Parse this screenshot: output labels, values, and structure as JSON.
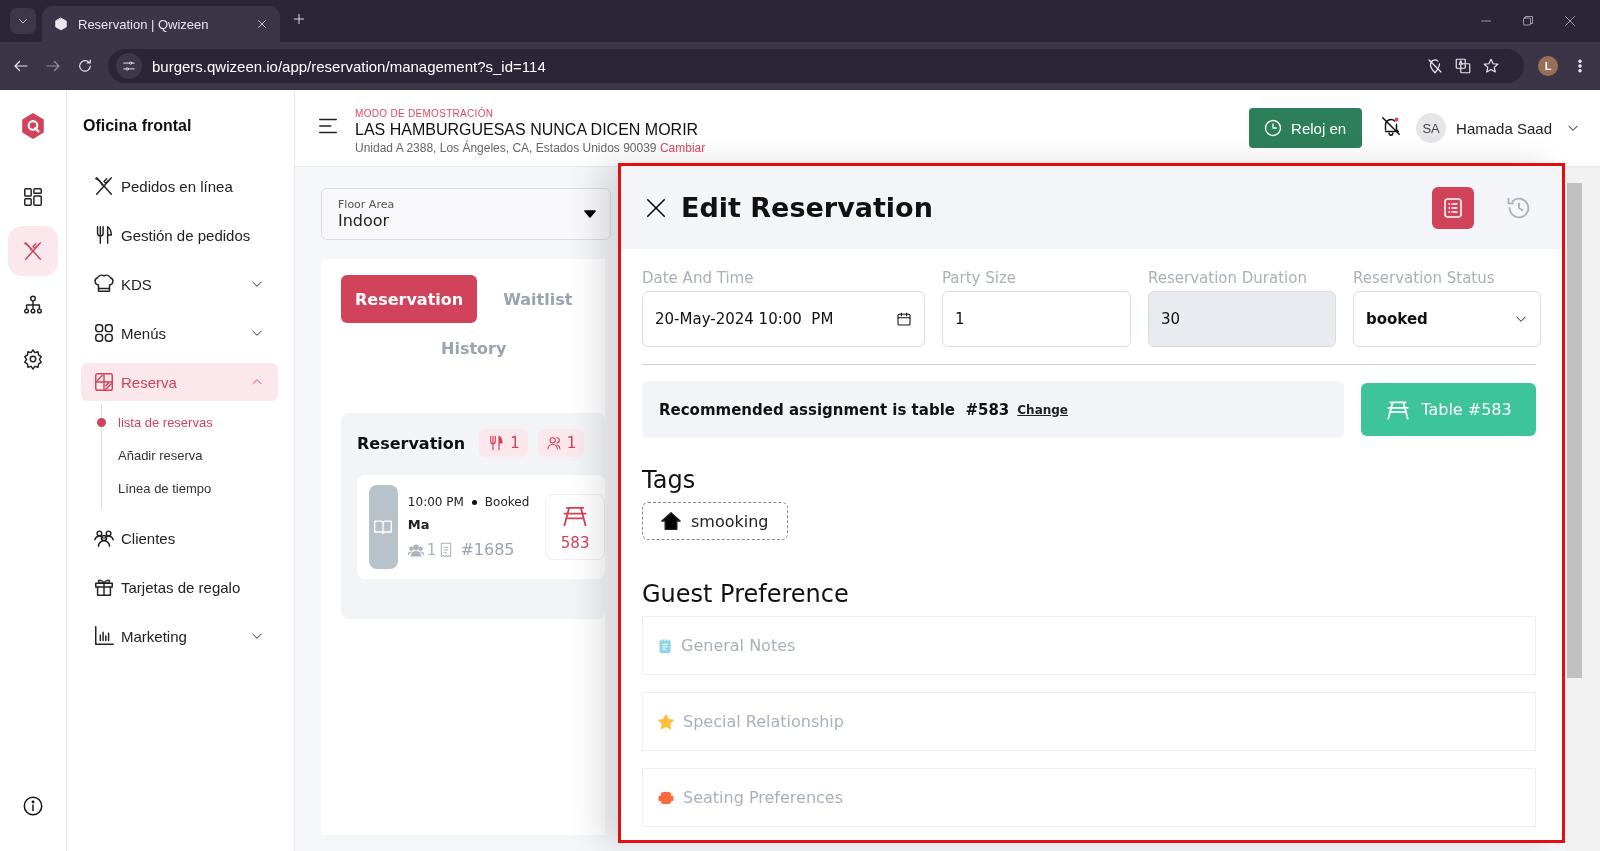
{
  "browser": {
    "tab_title": "Reservation | Qwizeen",
    "url": "burgers.qwizeen.io/app/reservation/management?s_id=114",
    "profile_initial": "L"
  },
  "rail": {
    "items": [
      {
        "kind": "dashboard",
        "selected": false
      },
      {
        "kind": "dining",
        "selected": true
      },
      {
        "kind": "hierarchy",
        "selected": false
      },
      {
        "kind": "settings",
        "selected": false
      }
    ]
  },
  "sidebar": {
    "title": "Oficina frontal",
    "items": [
      {
        "label": "Pedidos en línea",
        "kind": "dining",
        "selected": false
      },
      {
        "label": "Gestión de pedidos",
        "kind": "utensils",
        "selected": false
      },
      {
        "label": "KDS",
        "kind": "chef",
        "selected": false,
        "expanded": false
      },
      {
        "label": "Menús",
        "kind": "grid",
        "selected": false,
        "expanded": false
      },
      {
        "label": "Reserva",
        "kind": "floorplan",
        "selected": true,
        "expanded": true,
        "children": [
          {
            "label": "lista de reservas",
            "selected": true
          },
          {
            "label": "Añadir reserva",
            "selected": false
          },
          {
            "label": "Línea de tiempo",
            "selected": false
          }
        ]
      },
      {
        "label": "Clientes",
        "kind": "people",
        "selected": false
      },
      {
        "label": "Tarjetas de regalo",
        "kind": "gift",
        "selected": false
      },
      {
        "label": "Marketing",
        "kind": "chart",
        "selected": false,
        "expanded": false
      }
    ]
  },
  "header": {
    "demo_label": "MODO DE DEMOSTRACIÓN",
    "restaurant": "LAS HAMBURGUESAS NUNCA DICEN MORIR",
    "address": "Unidad A 2388, Los Ángeles, CA, Estados Unidos 90039",
    "change_link": "Cambiar",
    "clock_button": "Reloj en",
    "user_initials": "SA",
    "user_name": "Hamada Saad"
  },
  "floor_area": {
    "label": "Floor Area",
    "value": "Indoor"
  },
  "list_tabs": [
    {
      "label": "Reservation",
      "selected": true
    },
    {
      "label": "Waitlist",
      "selected": false
    },
    {
      "label": "History",
      "selected": false
    }
  ],
  "reservations": {
    "title": "Reservation",
    "counters": [
      {
        "kind": "covers",
        "value": "1"
      },
      {
        "kind": "guests",
        "value": "1"
      }
    ],
    "entries": [
      {
        "time": "10:00 PM",
        "status": "Booked",
        "name": "Ma",
        "party_size": "1",
        "order": "#1685",
        "table": "583"
      }
    ]
  },
  "edit_panel": {
    "highlighted": true,
    "title": "Edit Reservation",
    "views": [
      {
        "kind": "details",
        "selected": true
      },
      {
        "kind": "history",
        "selected": false
      }
    ],
    "fields": [
      {
        "kind": "date",
        "label": "Date And Time",
        "value": "20-May-2024 10:00  PM"
      },
      {
        "kind": "text",
        "label": "Party Size",
        "value": "1"
      },
      {
        "kind": "readonly",
        "label": "Reservation Duration",
        "value": "30"
      },
      {
        "kind": "select",
        "label": "Reservation Status",
        "value": "booked"
      }
    ],
    "recommendation": {
      "text": "Recommended assignment is table",
      "table": "#583",
      "link": "Change"
    },
    "table_button": "Table #583",
    "tags_title": "Tags",
    "tags": [
      {
        "label": "smooking"
      }
    ],
    "guest_preference_title": "Guest Preference",
    "preferences": [
      {
        "kind": "notes",
        "label": "General Notes"
      },
      {
        "kind": "star",
        "label": "Special Relationship"
      },
      {
        "kind": "seating",
        "label": "Seating Preferences"
      }
    ]
  }
}
